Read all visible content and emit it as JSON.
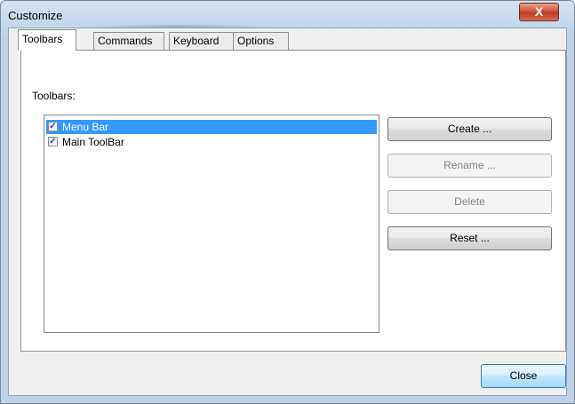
{
  "window": {
    "title": "Customize",
    "close_glyph": "X"
  },
  "tabs": [
    {
      "label": "Toolbars",
      "active": true
    },
    {
      "label": "Commands",
      "active": false
    },
    {
      "label": "Keyboard",
      "active": false
    },
    {
      "label": "Options",
      "active": false
    }
  ],
  "toolbars_page": {
    "list_label": "Toolbars:",
    "items": [
      {
        "label": "Menu Bar",
        "checked": true,
        "selected": true
      },
      {
        "label": "Main ToolBar",
        "checked": true,
        "selected": false
      }
    ],
    "buttons": [
      {
        "label": "Create ...",
        "enabled": true
      },
      {
        "label": "Rename ...",
        "enabled": false
      },
      {
        "label": "Delete",
        "enabled": false
      },
      {
        "label": "Reset ...",
        "enabled": true
      }
    ]
  },
  "footer": {
    "close_label": "Close"
  },
  "colors": {
    "selection": "#3399ff",
    "check": "#2a4ea4"
  }
}
